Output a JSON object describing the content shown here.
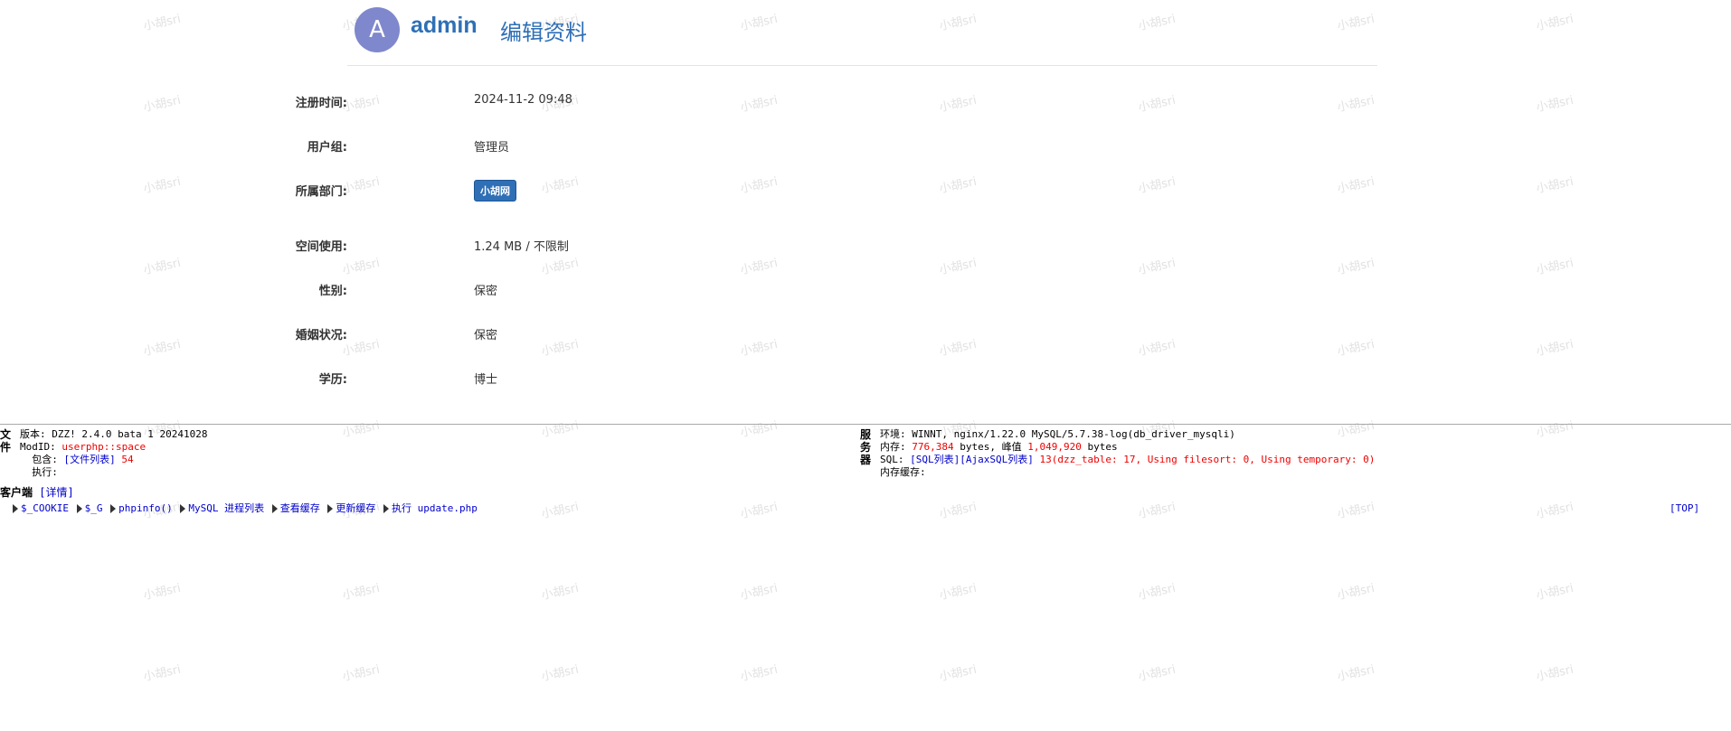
{
  "watermark": {
    "text": "小胡sri"
  },
  "profile": {
    "avatar_letter": "A",
    "username": "admin",
    "edit_label": "编辑资料"
  },
  "info": {
    "reg_time": {
      "label": "注册时间:",
      "value": "2024-11-2 09:48"
    },
    "user_group": {
      "label": "用户组:",
      "value": "管理员"
    },
    "department": {
      "label": "所属部门:",
      "value": "小胡网"
    },
    "space": {
      "label": "空间使用:",
      "value": "1.24 MB / 不限制"
    },
    "gender": {
      "label": "性别:",
      "value": "保密"
    },
    "marital": {
      "label": "婚姻状况:",
      "value": "保密"
    },
    "education": {
      "label": "学历:",
      "value": "博士"
    }
  },
  "debug": {
    "file": {
      "heading": "文件",
      "version_label": "版本:",
      "version_value": "DZZ! 2.4.0 bata 1 20241028",
      "modid_label": "ModID:",
      "modid_value": "userphp::space",
      "include_label": "包含:",
      "include_link": "[文件列表]",
      "include_count": "54",
      "exec_label": "执行:"
    },
    "server": {
      "heading": "服务器",
      "env_label": "环境:",
      "env_value": "WINNT, nginx/1.22.0 MySQL/5.7.38-log(db_driver_mysqli)",
      "mem_label": "内存:",
      "mem_value": "776,384",
      "mem_unit": "bytes, 峰值",
      "mem_peak": "1,049,920",
      "mem_peak_unit": "bytes",
      "sql_label": "SQL:",
      "sql_link": "[SQL列表]",
      "ajax_sql_link": "[AjaxSQL列表]",
      "sql_stats": "13(dzz_table: 17, Using filesort: 0, Using temporary: 0)",
      "cache_label": "内存缓存:"
    },
    "client": {
      "label": "客户端",
      "detail_link": "[详情]"
    },
    "toolbar": {
      "cookie": "$_COOKIE",
      "g": "$_G",
      "phpinfo": "phpinfo()",
      "mysql_proc": "MySQL 进程列表",
      "view_cache": "查看缓存",
      "update_cache": "更新缓存",
      "exec_label": "执行",
      "exec_link": "update.php",
      "top": "[TOP]"
    }
  },
  "colors": {
    "accent": "#2f6fb6",
    "avatar_bg": "#7f88cc",
    "debug_red": "#ee0000",
    "debug_link": "#0000cc"
  }
}
